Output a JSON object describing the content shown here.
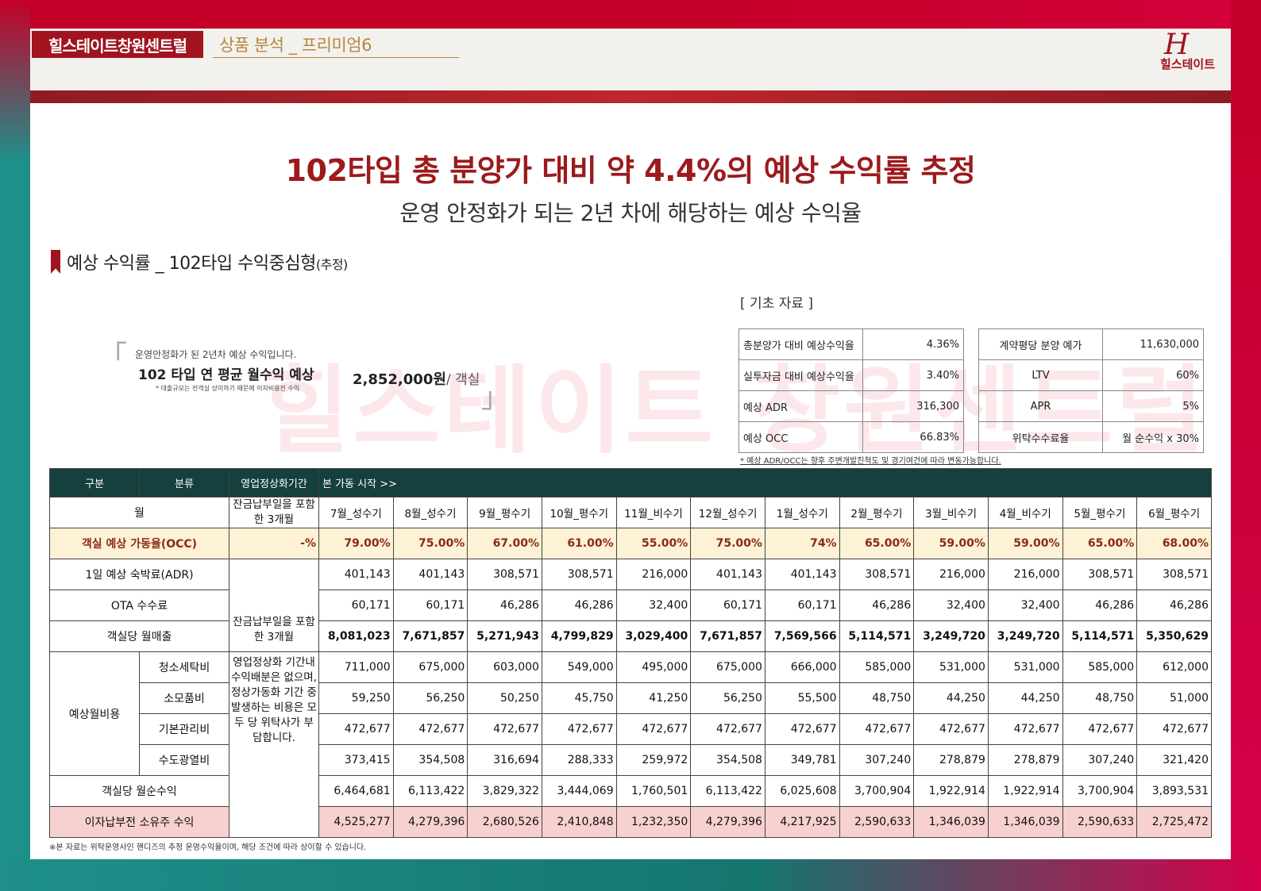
{
  "header": {
    "brand": "힐스테이트창원센트럴",
    "section": "상품 분석 _ 프리미엄6",
    "logo_mark": "H",
    "logo_text": "힐스테이트"
  },
  "title": "102타입 총 분양가 대비 약 4.4%의 예상 수익률 추정",
  "subtitle": "운영 안정화가 되는 2년 차에 해당하는 예상 수익율",
  "section_head": {
    "text": "예상 수익률 _ 102타입 수익중심형",
    "suffix": "(추정)"
  },
  "monthly": {
    "open_quote": "「",
    "close_quote": "」",
    "small": "운영안정화가 된 2년차 예상 수익입니다.",
    "main": "102 타입 연 평균 월수익 예상",
    "note": "* 대출규모는 전객실 상이하기 때문에 이자비용전 수익",
    "value": "2,852,000원",
    "unit": "/ 객실"
  },
  "watermark": "힐스테이트 창원센트럴",
  "basic": {
    "title": "[ 기초 자료 ]",
    "left": [
      {
        "label": "총분양가 대비 예상수익율",
        "value": "4.36%"
      },
      {
        "label": "실투자금 대비 예상수익율",
        "value": "3.40%"
      },
      {
        "label": "예상 ADR",
        "value": "316,300"
      },
      {
        "label": "예상 OCC",
        "value": "66.83%"
      }
    ],
    "right": [
      {
        "label": "계약평당 분양 예가",
        "value": "11,630,000"
      },
      {
        "label": "LTV",
        "value": "60%"
      },
      {
        "label": "APR",
        "value": "5%"
      },
      {
        "label": "위탁수수료율",
        "value": "월 순수익 x 30%"
      }
    ],
    "note": "* 예상 ADR/OCC는 향후 주변개발진척도 및 경기여건에 따라 변동가능합니다."
  },
  "table": {
    "header": {
      "col1": "구분",
      "col2": "분류",
      "col3": "영업정상화기간",
      "col4": "본 가동 시작 >>"
    },
    "month_label": "월",
    "period_head": "잔금납부일을 포함한 3개월",
    "months": [
      "7월_성수기",
      "8월_성수기",
      "9월_평수기",
      "10월_평수기",
      "11월_비수기",
      "12월_성수기",
      "1월_성수기",
      "2월_평수기",
      "3월_비수기",
      "4월_비수기",
      "5월_평수기",
      "6월_평수기"
    ],
    "occ": {
      "label": "객실 예상 가동율(OCC)",
      "period": "-%",
      "values": [
        "79.00%",
        "75.00%",
        "67.00%",
        "61.00%",
        "55.00%",
        "75.00%",
        "74%",
        "65.00%",
        "59.00%",
        "59.00%",
        "65.00%",
        "68.00%"
      ]
    },
    "adr": {
      "label": "1일 예상 숙박료(ADR)",
      "values": [
        "401,143",
        "401,143",
        "308,571",
        "308,571",
        "216,000",
        "401,143",
        "401,143",
        "308,571",
        "216,000",
        "216,000",
        "308,571",
        "308,571"
      ]
    },
    "ota": {
      "label": "OTA 수수료",
      "values": [
        "60,171",
        "60,171",
        "46,286",
        "46,286",
        "32,400",
        "60,171",
        "60,171",
        "46,286",
        "32,400",
        "32,400",
        "46,286",
        "46,286"
      ]
    },
    "sales": {
      "label": "객실당 월매출",
      "values": [
        "8,081,023",
        "7,671,857",
        "5,271,943",
        "4,799,829",
        "3,029,400",
        "7,671,857",
        "7,569,566",
        "5,114,571",
        "3,249,720",
        "3,249,720",
        "5,114,571",
        "5,350,629"
      ]
    },
    "period_mid": "잔금납부일을 포함한 3개월",
    "period_note": "영업정상화 기간내 수익배분은 없으며, 정상가동화 기간 중 발생하는 비용은 모두 당 위탁사가 부담합니다.",
    "expense_label": "예상월비용",
    "expenses": [
      {
        "label": "청소세탁비",
        "values": [
          "711,000",
          "675,000",
          "603,000",
          "549,000",
          "495,000",
          "675,000",
          "666,000",
          "585,000",
          "531,000",
          "531,000",
          "585,000",
          "612,000"
        ]
      },
      {
        "label": "소모품비",
        "values": [
          "59,250",
          "56,250",
          "50,250",
          "45,750",
          "41,250",
          "56,250",
          "55,500",
          "48,750",
          "44,250",
          "44,250",
          "48,750",
          "51,000"
        ]
      },
      {
        "label": "기본관리비",
        "values": [
          "472,677",
          "472,677",
          "472,677",
          "472,677",
          "472,677",
          "472,677",
          "472,677",
          "472,677",
          "472,677",
          "472,677",
          "472,677",
          "472,677"
        ]
      },
      {
        "label": "수도광열비",
        "values": [
          "373,415",
          "354,508",
          "316,694",
          "288,333",
          "259,972",
          "354,508",
          "349,781",
          "307,240",
          "278,879",
          "278,879",
          "307,240",
          "321,420"
        ]
      }
    ],
    "net": {
      "label": "객실당 월순수익",
      "values": [
        "6,464,681",
        "6,113,422",
        "3,829,322",
        "3,444,069",
        "1,760,501",
        "6,113,422",
        "6,025,608",
        "3,700,904",
        "1,922,914",
        "1,922,914",
        "3,700,904",
        "3,893,531"
      ]
    },
    "owner": {
      "label": "이자납부전 소유주 수익",
      "values": [
        "4,525,277",
        "4,279,396",
        "2,680,526",
        "2,410,848",
        "1,232,350",
        "4,279,396",
        "4,217,925",
        "2,590,633",
        "1,346,039",
        "1,346,039",
        "2,590,633",
        "2,725,472"
      ]
    }
  },
  "footnote": "※본 자료는 위탁운영사인 핸디즈의 추정 운영수익율이며, 해당 조건에 따라 상이할 수 있습니다."
}
